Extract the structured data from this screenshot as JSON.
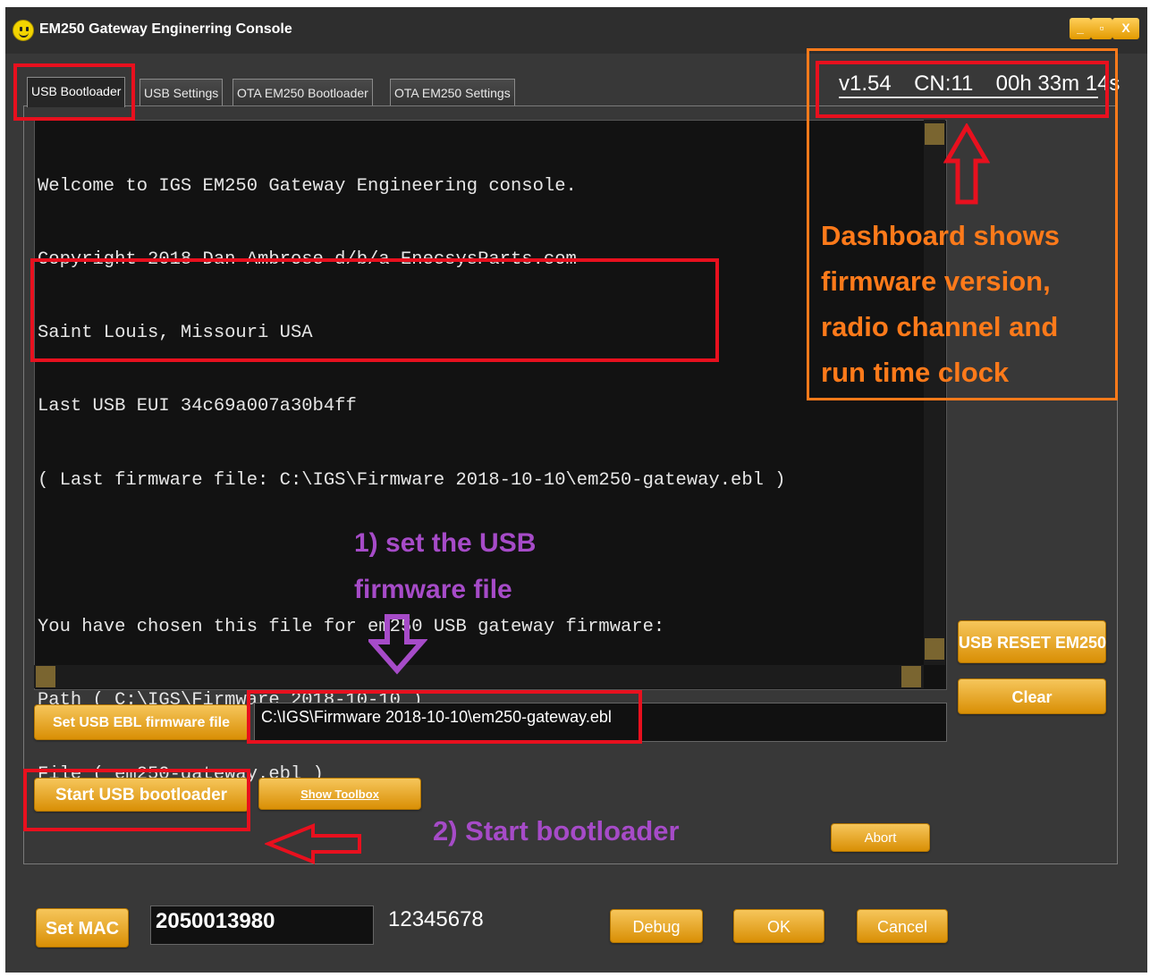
{
  "window": {
    "title": "EM250 Gateway Enginerring Console",
    "controls": {
      "minimize": "_",
      "maximize": "▫",
      "close": "X"
    }
  },
  "tabs": [
    {
      "label": "USB Bootloader",
      "active": true
    },
    {
      "label": "USB Settings",
      "active": false
    },
    {
      "label": "OTA EM250 Bootloader",
      "active": false
    },
    {
      "label": "OTA EM250 Settings",
      "active": false
    }
  ],
  "dashboard": {
    "version": "v1.54",
    "channel": "CN:11",
    "runtime": "00h 33m 14s"
  },
  "console": {
    "lines": [
      "Welcome to IGS EM250 Gateway Engineering console.",
      "Copyright 2018 Dan Ambrose d/b/a EnecsysParts.com",
      "Saint Louis, Missouri USA",
      "Last USB EUI 34c69a007a30b4ff",
      "( Last firmware file: C:\\IGS\\Firmware 2018-10-10\\em250-gateway.ebl )",
      "",
      "You have chosen this file for em250 USB gateway firmware:",
      "Path ( C:\\IGS\\Firmware 2018-10-10 )",
      "File ( em250-gateway.ebl )"
    ]
  },
  "buttons": {
    "usb_reset": "USB RESET EM250",
    "clear": "Clear",
    "set_ebl": "Set USB EBL firmware file",
    "start_bootloader": "Start USB bootloader",
    "show_toolbox": "Show Toolbox",
    "abort": "Abort",
    "set_mac": "Set MAC",
    "debug": "Debug",
    "ok": "OK",
    "cancel": "Cancel"
  },
  "fields": {
    "firmware_path": "C:\\IGS\\Firmware 2018-10-10\\em250-gateway.ebl",
    "mac_value": "2050013980",
    "serial_label": "12345678"
  },
  "annotations": {
    "dashboard_note": [
      "Dashboard shows",
      "firmware version,",
      "radio channel and",
      "run time clock"
    ],
    "step1": [
      "1)  set the USB",
      "firmware file"
    ],
    "step2": "2) Start bootloader"
  },
  "colors": {
    "accent_gold": "#e8a417",
    "annotation_red": "#e8101e",
    "annotation_orange": "#ff7a1a",
    "annotation_purple": "#a64bc8"
  }
}
